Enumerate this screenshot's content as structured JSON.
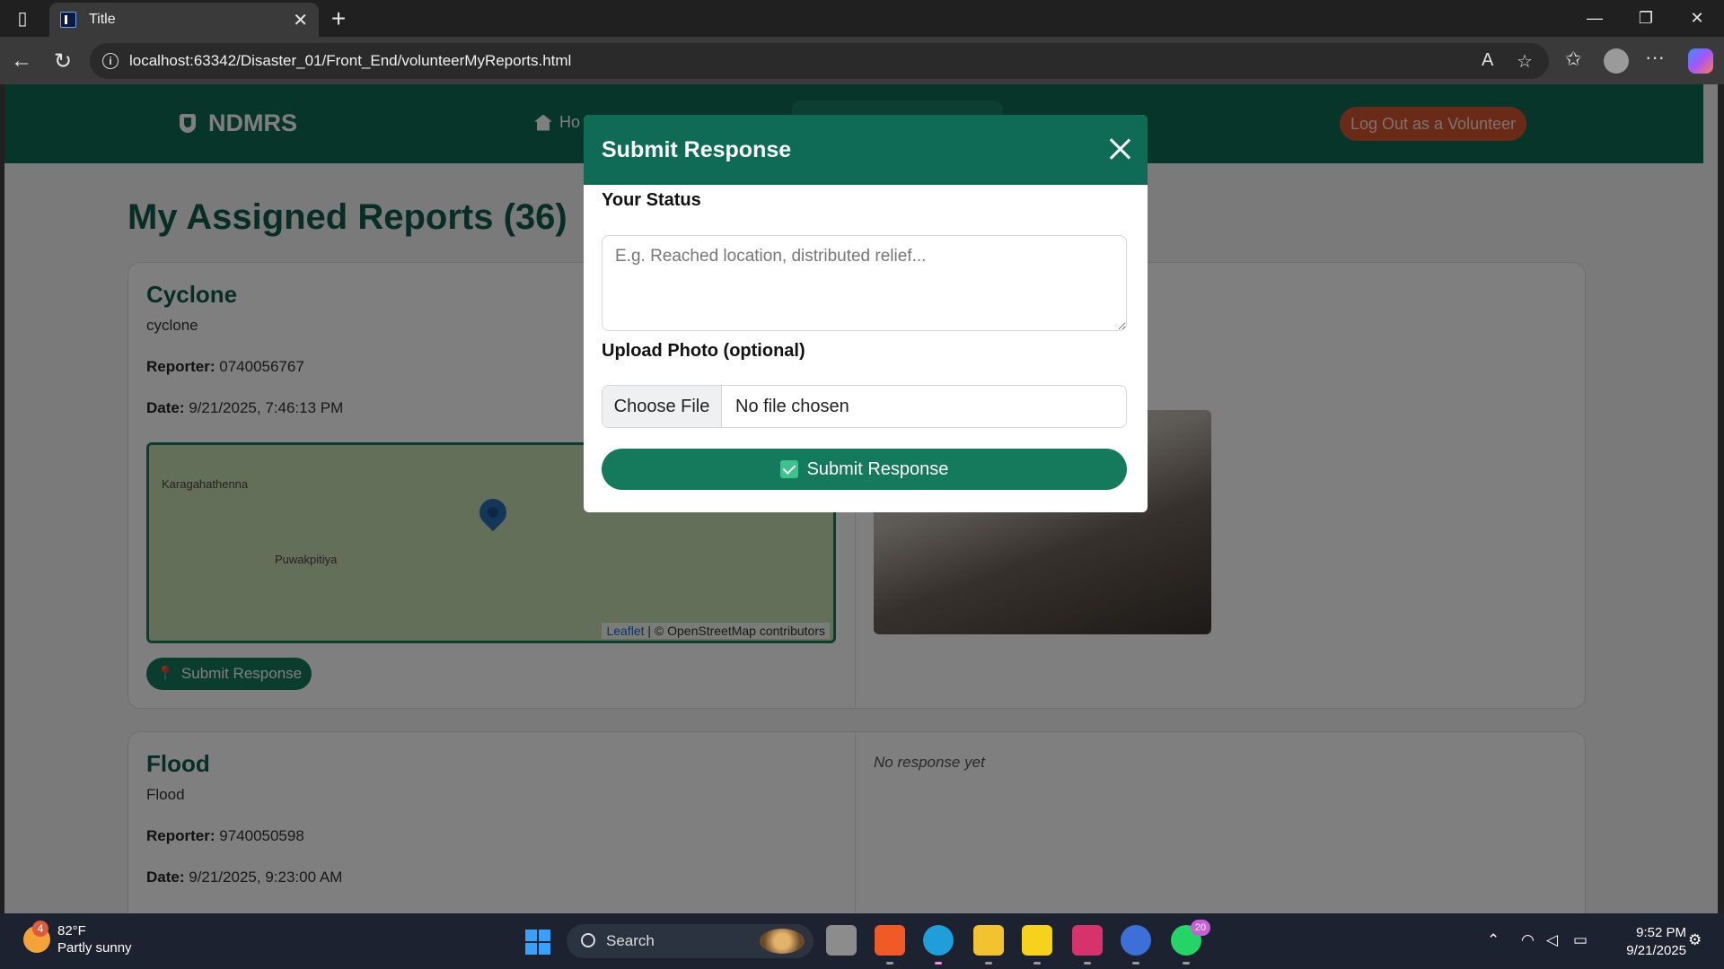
{
  "browser": {
    "tab_title": "Title",
    "url": "localhost:63342/Disaster_01/Front_End/volunteerMyReports.html",
    "icons": [
      "sidebar-icon",
      "close-icon",
      "plus-icon",
      "minimize-icon",
      "restore-icon",
      "close-window-icon",
      "back-icon",
      "reload-icon",
      "info-icon",
      "read-aloud-icon",
      "star-icon",
      "favorites-icon",
      "profile-icon",
      "more-icon",
      "copilot-icon"
    ]
  },
  "navbar": {
    "brand": "NDMRS",
    "home_label": "Ho",
    "logout_label": "Log Out as a Volunteer"
  },
  "page": {
    "title": "My Assigned Reports (36)"
  },
  "reports": [
    {
      "title": "Cyclone",
      "subtitle": "cyclone",
      "reporter_label": "Reporter:",
      "reporter": "0740056767",
      "date_label": "Date:",
      "date": "9/21/2025, 7:46:13 PM",
      "map_places": [
        "Karagahathenna",
        "Puwakpitiya"
      ],
      "map_attribution_link": "Leaflet",
      "map_attribution_text": "| © OpenStreetMap contributors",
      "submit_label": "Submit Response"
    },
    {
      "title": "Flood",
      "subtitle": "Flood",
      "reporter_label": "Reporter:",
      "reporter": "9740050598",
      "date_label": "Date:",
      "date": "9/21/2025, 9:23:00 AM",
      "response_text": "No response yet"
    }
  ],
  "modal": {
    "title": "Submit Response",
    "status_label": "Your Status",
    "status_placeholder": "E.g. Reached location, distributed relief...",
    "photo_label": "Upload Photo (optional)",
    "choose_file_label": "Choose File",
    "file_status": "No file chosen",
    "submit_label": "Submit Response"
  },
  "taskbar": {
    "weather_temp": "82°F",
    "weather_desc": "Partly sunny",
    "weather_badge": "4",
    "search_label": "Search",
    "whatsapp_badge": "20",
    "time": "9:52 PM",
    "date": "9/21/2025"
  },
  "colors": {
    "brand_green": "#0f6b55",
    "button_green": "#157a5b",
    "logout_red": "#d2552f",
    "title_green": "#0f5c4a"
  }
}
